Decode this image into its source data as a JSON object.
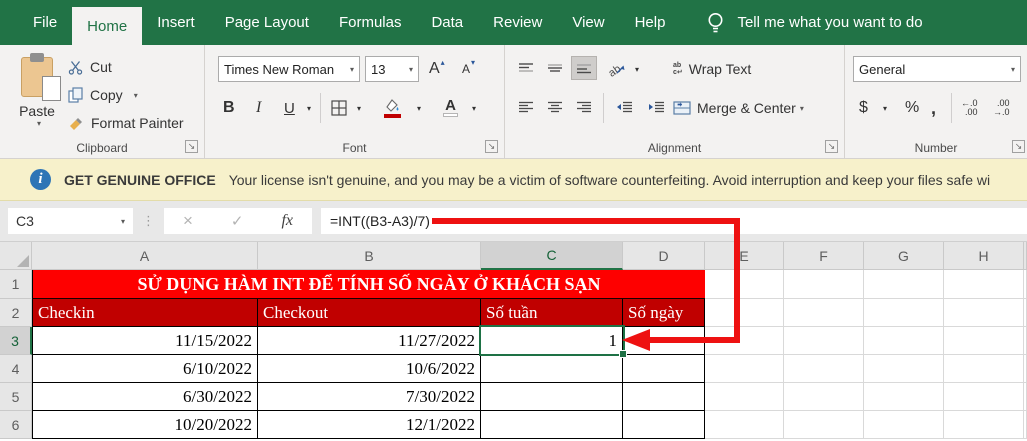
{
  "tabs": {
    "items": [
      "File",
      "Home",
      "Insert",
      "Page Layout",
      "Formulas",
      "Data",
      "Review",
      "View",
      "Help"
    ],
    "active": "Home",
    "tell_me": "Tell me what you want to do"
  },
  "ribbon": {
    "clipboard": {
      "label": "Clipboard",
      "paste": "Paste",
      "cut": "Cut",
      "copy": "Copy",
      "format_painter": "Format Painter"
    },
    "font": {
      "label": "Font",
      "name": "Times New Roman",
      "size": "13",
      "bold": "B",
      "italic": "I",
      "underline": "U",
      "grow": "A",
      "shrink": "A",
      "color_letter": "A"
    },
    "alignment": {
      "label": "Alignment",
      "wrap_text": "Wrap Text",
      "merge_center": "Merge & Center",
      "orient_glyph": "ab",
      "wrap_glyph_1": "ab",
      "wrap_glyph_2": "c↵"
    },
    "number": {
      "label": "Number",
      "format": "General",
      "currency": "$",
      "percent": "%",
      "comma": ",",
      "inc_dec_1": "←.0",
      "inc_dec_2": ".00",
      "dec_dec_1": ".00",
      "dec_dec_2": "→.0"
    }
  },
  "notice": {
    "info_glyph": "i",
    "title": "GET GENUINE OFFICE",
    "message": "Your license isn't genuine, and you may be a victim of software counterfeiting. Avoid interruption and keep your files safe wi"
  },
  "formula_bar": {
    "name_box": "C3",
    "dots": "⋮",
    "cancel": "×",
    "enter": "✓",
    "fx": "fx",
    "formula": "=INT((B3-A3)/7)"
  },
  "icons": {
    "dropdown": "▾",
    "launcher": "↘",
    "caret_up": "▴",
    "caret_down": "▾"
  },
  "sheet": {
    "columns": [
      "A",
      "B",
      "C",
      "D",
      "E",
      "F",
      "G",
      "H"
    ],
    "row_numbers": [
      "1",
      "2",
      "3",
      "4",
      "5",
      "6"
    ],
    "title": "SỬ DỤNG HÀM INT ĐỂ TÍNH SỐ NGÀY Ở KHÁCH SẠN",
    "headers": [
      "Checkin",
      "Checkout",
      "Số tuần",
      "Số ngày"
    ],
    "rows": [
      [
        "11/15/2022",
        "11/27/2022",
        "1",
        ""
      ],
      [
        "6/10/2022",
        "10/6/2022",
        "",
        ""
      ],
      [
        "6/30/2022",
        "7/30/2022",
        "",
        ""
      ],
      [
        "10/20/2022",
        "12/1/2022",
        "",
        ""
      ]
    ],
    "selected_cell": "C3"
  },
  "colors": {
    "excel_green": "#217346",
    "banner_red": "#FE0000",
    "header_dark_red": "#C00000",
    "arrow_red": "#EE1111",
    "notice_yellow": "#F7F1CB"
  }
}
